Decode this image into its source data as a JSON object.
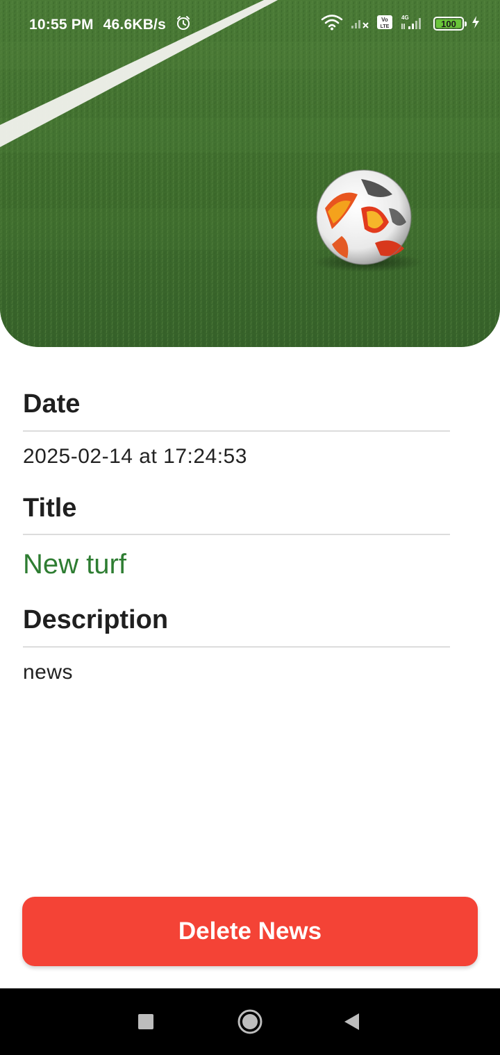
{
  "status_bar": {
    "time": "10:55 PM",
    "speed": "46.6KB/s",
    "network_badge": "Vo LTE",
    "network_type": "4G",
    "battery": "100"
  },
  "hero": {
    "image_icon": "soccer-ball-on-turf"
  },
  "details": {
    "date_label": "Date",
    "date_value": "2025-02-14 at 17:24:53",
    "title_label": "Title",
    "title_value": "New turf",
    "description_label": "Description",
    "description_value": "news"
  },
  "actions": {
    "delete_label": "Delete News"
  },
  "nav": {
    "recents_icon": "square-icon",
    "home_icon": "circle-icon",
    "back_icon": "triangle-back-icon"
  },
  "colors": {
    "accent_red": "#f44336",
    "title_green": "#2e7d32",
    "battery_green": "#69c53a"
  }
}
